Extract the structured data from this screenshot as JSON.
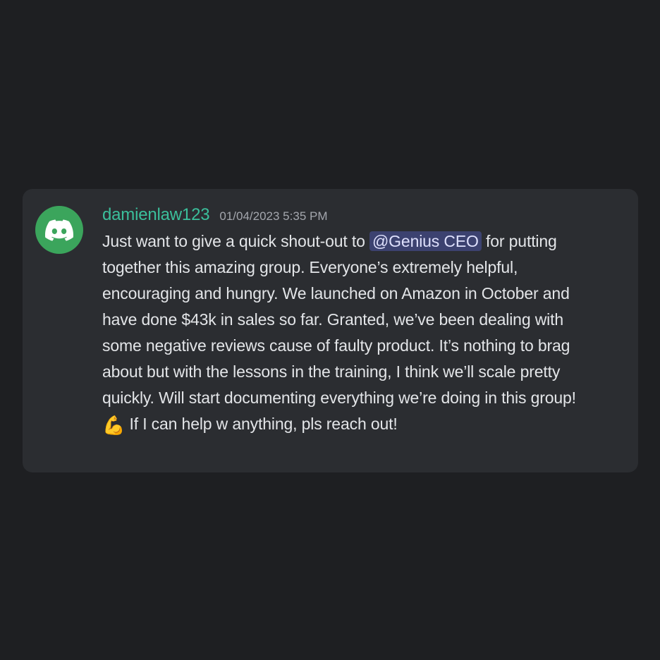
{
  "message": {
    "username": "damienlaw123",
    "timestamp": "01/04/2023 5:35 PM",
    "text_before_mention": "Just want to give a quick shout-out to ",
    "mention": "@Genius CEO",
    "text_after_mention": "  for putting together this amazing group. Everyone’s extremely helpful, encouraging and hungry. We launched on Amazon in October and have done $43k in sales so far. Granted, we’ve been dealing with some negative reviews cause of faulty product. It’s nothing to brag about but with the lessons in the training, I think we’ll scale pretty quickly. Will start documenting everything we’re doing in this group! ",
    "emoji": "💪",
    "text_after_emoji": " If I can help w anything, pls reach out!"
  },
  "avatar": {
    "icon": "discord-logo-icon",
    "color": "#3ba55c"
  },
  "colors": {
    "background": "#1e1f22",
    "card": "#2b2d31",
    "username": "#3bbf9b",
    "mention_bg": "#3c4270"
  }
}
